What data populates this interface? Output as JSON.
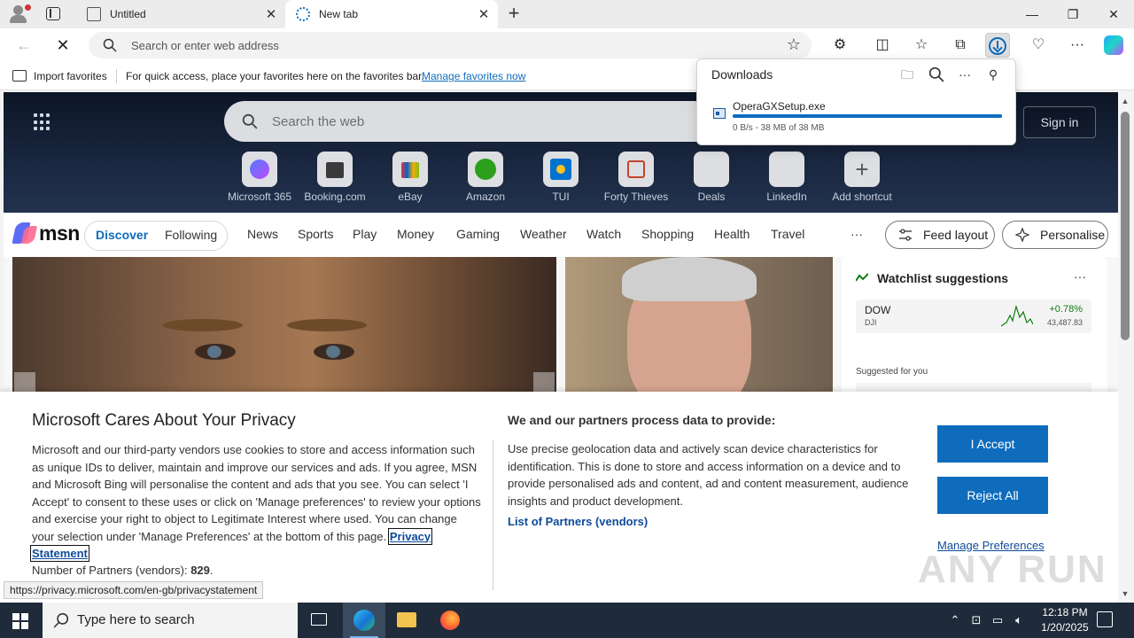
{
  "browser": {
    "tabs": [
      {
        "label": "Untitled",
        "close": "✕"
      },
      {
        "label": "New tab",
        "close": "✕"
      }
    ],
    "new_tab_symbol": "+",
    "window_controls": [
      "—",
      "❐",
      "✕"
    ],
    "address_placeholder": "Search or enter web address",
    "favorites_bar": {
      "import_label": "Import favorites",
      "message": "For quick access, place your favorites here on the favorites bar.",
      "manage_link": "Manage favorites now"
    }
  },
  "downloads": {
    "title": "Downloads",
    "file_name": "OperaGXSetup.exe",
    "progress_text": "0 B/s - 38 MB of 38 MB",
    "progress_fraction": 1.0
  },
  "newtab": {
    "search_placeholder": "Search the web",
    "sign_in": "Sign in",
    "shortcuts": [
      "Microsoft 365",
      "Booking.com",
      "eBay",
      "Amazon",
      "TUI",
      "Forty Thieves",
      "Deals",
      "LinkedIn",
      "Add shortcut"
    ]
  },
  "msn": {
    "logo_text": "msn",
    "pills": [
      "Discover",
      "Following"
    ],
    "categories": [
      "News",
      "Sports",
      "Play",
      "Money",
      "Gaming",
      "Weather",
      "Watch",
      "Shopping",
      "Health",
      "Travel"
    ],
    "more": "···",
    "feed_layout": "Feed layout",
    "personalise": "Personalise"
  },
  "watchlist": {
    "title": "Watchlist suggestions",
    "more": "···",
    "stock": {
      "symbol": "DOW",
      "sub": "DJI",
      "change": "+0.78%",
      "value": "43,487.83"
    },
    "suggested_label": "Suggested for you"
  },
  "privacy": {
    "heading": "Microsoft Cares About Your Privacy",
    "body": "Microsoft and our third-party vendors use cookies to store and access information such as unique IDs to deliver, maintain and improve our services and ads. If you agree, MSN and Microsoft Bing will personalise the content and ads that you see. You can select 'I Accept' to consent to these uses or click on 'Manage preferences' to review your options and exercise your right to object to Legitimate Interest where used.  You can change your selection under 'Manage Preferences' at the bottom of this page. ",
    "privacy_link": "Privacy Statement",
    "partners_label": "Number of Partners (vendors): ",
    "partners_count": "829",
    "partners_tail": ".",
    "heading2": "We and our partners process data to provide:",
    "body2": "Use precise geolocation data and actively scan device characteristics for identification. This is done to store and access information on a device and to provide personalised ads and content, ad and content measurement, audience insights and product development.",
    "list_partners": "List of Partners (vendors)",
    "accept": "I Accept",
    "reject": "Reject All",
    "manage": "Manage Preferences"
  },
  "status_url": "https://privacy.microsoft.com/en-gb/privacystatement",
  "watermark": "ANY RUN",
  "taskbar": {
    "search_placeholder": "Type here to search",
    "time": "12:18 PM",
    "date": "1/20/2025"
  },
  "colors": {
    "accent": "#0f6cbd",
    "taskbar": "#1f2b3a",
    "stock_up": "#107c10"
  }
}
